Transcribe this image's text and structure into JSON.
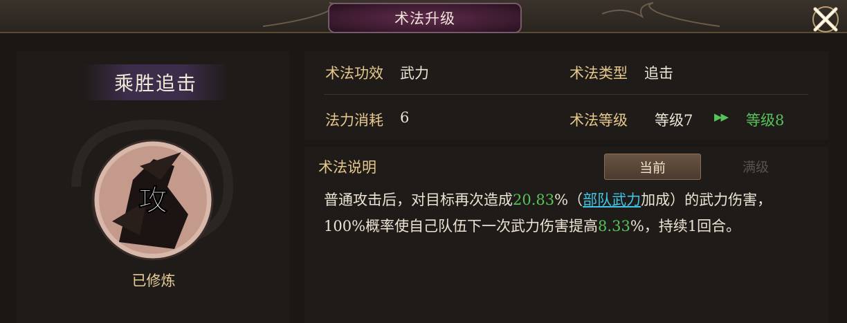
{
  "dialog": {
    "title": "术法升级"
  },
  "skill": {
    "name": "乘胜追击",
    "icon_glyph": "攻",
    "status": "已修炼"
  },
  "info": {
    "effect_label": "术法功效",
    "effect_value": "武力",
    "type_label": "术法类型",
    "type_value": "追击",
    "cost_label": "法力消耗",
    "cost_value": "6",
    "level_label": "术法等级",
    "level_current": "等级7",
    "level_next": "等级8"
  },
  "description": {
    "title": "术法说明",
    "tabs": {
      "current": "当前",
      "max": "满级"
    },
    "line1_a": "普通攻击后，对目标再次造成",
    "line1_pct": "20.83",
    "line1_b": "%（",
    "line1_link": "部队武力",
    "line1_c": "加成）的武力伤害，",
    "line2_a": "100%概率使自己队伍下一次武力伤害提高",
    "line2_pct": "8.33",
    "line2_b": "%，持续1回合。"
  },
  "colors": {
    "accent_gold": "#e6c88c",
    "highlight_green": "#58c25a",
    "link_cyan": "#3ec6e8"
  }
}
